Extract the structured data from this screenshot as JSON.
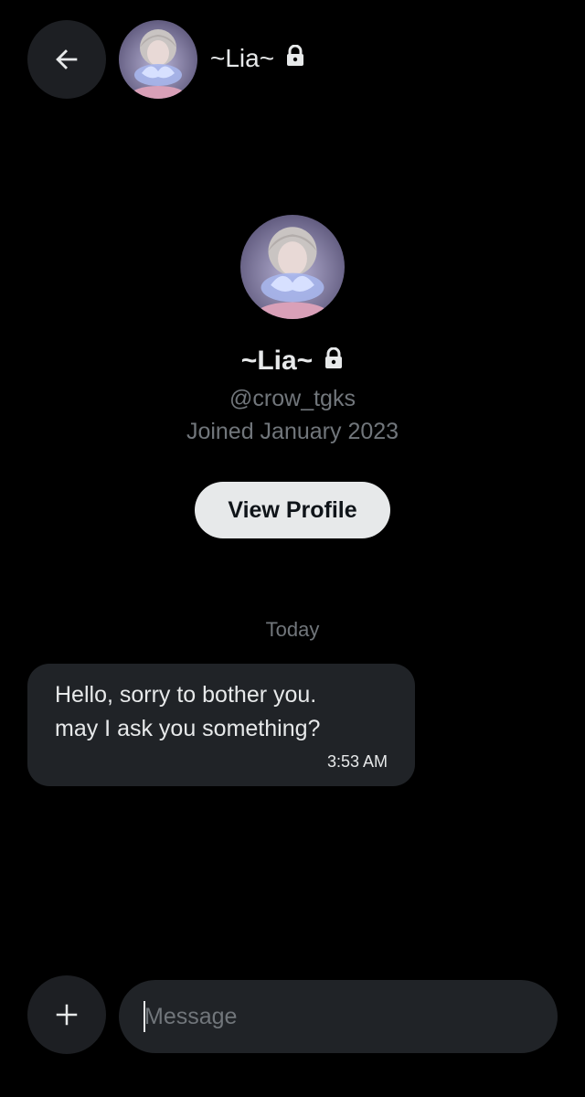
{
  "header": {
    "back_icon": "arrow-left-icon",
    "name": "~Lia~",
    "lock_icon": "lock-icon"
  },
  "profile": {
    "name": "~Lia~",
    "handle": "@crow_tgks",
    "joined": "Joined January 2023",
    "view_profile_label": "View Profile"
  },
  "conversation": {
    "date_separator": "Today",
    "messages": [
      {
        "text_line1": "Hello, sorry to bother you.",
        "text_line2": "may I ask you something?",
        "time": "3:53 AM"
      }
    ]
  },
  "composer": {
    "add_icon": "plus-icon",
    "placeholder": "Message",
    "value": ""
  },
  "colors": {
    "background": "#000000",
    "surface": "#202327",
    "button_dark": "#1d1f23",
    "text_primary": "#e7e9ea",
    "text_secondary": "#71767b",
    "pill_button": "#e7e9ea"
  }
}
